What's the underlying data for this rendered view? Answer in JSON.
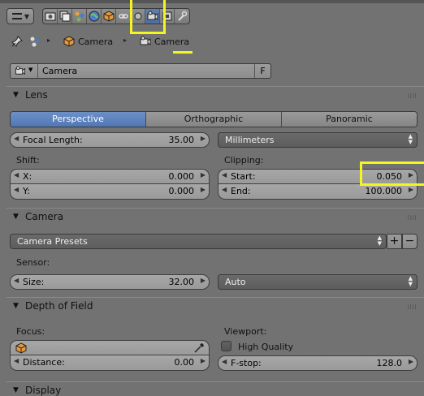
{
  "breadcrumb": {
    "items": [
      "Camera",
      "Camera"
    ]
  },
  "datablock": {
    "name": "Camera",
    "fake_user": "F"
  },
  "lens": {
    "title": "Lens",
    "tabs": [
      "Perspective",
      "Orthographic",
      "Panoramic"
    ],
    "active_tab": "Perspective",
    "focal_length_label": "Focal Length:",
    "focal_length_value": "35.00",
    "unit_label": "Millimeters",
    "shift_label": "Shift:",
    "shift_x_label": "X:",
    "shift_x_value": "0.000",
    "shift_y_label": "Y:",
    "shift_y_value": "0.000",
    "clipping_label": "Clipping:",
    "clip_start_label": "Start:",
    "clip_start_value": "0.050",
    "clip_end_label": "End:",
    "clip_end_value": "100.000"
  },
  "camera": {
    "title": "Camera",
    "presets_label": "Camera Presets",
    "sensor_label": "Sensor:",
    "size_label": "Size:",
    "size_value": "32.00",
    "fit_label": "Auto"
  },
  "dof": {
    "title": "Depth of Field",
    "focus_label": "Focus:",
    "distance_label": "Distance:",
    "distance_value": "0.00",
    "viewport_label": "Viewport:",
    "high_quality_label": "High Quality",
    "fstop_label": "F-stop:",
    "fstop_value": "128.0"
  },
  "display": {
    "title": "Display"
  },
  "colors": {
    "active_tab": "#5a7fbd",
    "highlight": "#f5f520",
    "panel_bg": "#727272"
  }
}
